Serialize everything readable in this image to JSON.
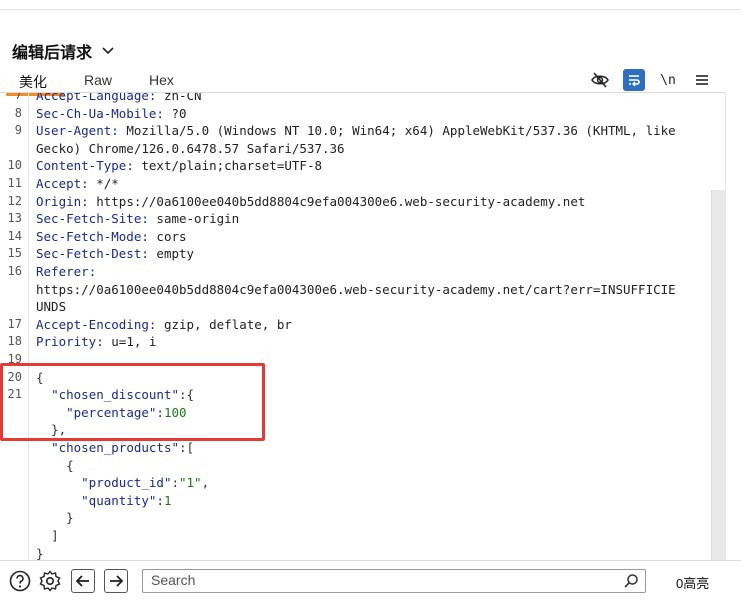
{
  "header": {
    "title": "编辑后请求"
  },
  "tabs": [
    {
      "label": "美化",
      "active": true
    },
    {
      "label": "Raw",
      "active": false
    },
    {
      "label": "Hex",
      "active": false
    }
  ],
  "toolbar": {
    "icons": [
      "eye-slash-icon",
      "wrap-text-icon",
      "newline-icon",
      "menu-icon"
    ],
    "newline_label": "\\n"
  },
  "editor": {
    "lines": [
      {
        "num": "7",
        "key": "Accept-Language",
        "sep": ": ",
        "value": "zh-CN"
      },
      {
        "num": "8",
        "key": "Sec-Ch-Ua-Mobile",
        "sep": ": ",
        "value": "?0"
      },
      {
        "num": "9",
        "key": "User-Agent",
        "sep": ": ",
        "value": "Mozilla/5.0 (Windows NT 10.0; Win64; x64) AppleWebKit/537.36 (KHTML, like"
      },
      {
        "num": "",
        "key": "",
        "sep": "",
        "value": "Gecko) Chrome/126.0.6478.57 Safari/537.36"
      },
      {
        "num": "10",
        "key": "Content-Type",
        "sep": ": ",
        "value": "text/plain;charset=UTF-8"
      },
      {
        "num": "11",
        "key": "Accept",
        "sep": ": ",
        "value": "*/*"
      },
      {
        "num": "12",
        "key": "Origin",
        "sep": ": ",
        "value": "https://0a6100ee040b5dd8804c9efa004300e6.web-security-academy.net"
      },
      {
        "num": "13",
        "key": "Sec-Fetch-Site",
        "sep": ": ",
        "value": "same-origin"
      },
      {
        "num": "14",
        "key": "Sec-Fetch-Mode",
        "sep": ": ",
        "value": "cors"
      },
      {
        "num": "15",
        "key": "Sec-Fetch-Dest",
        "sep": ": ",
        "value": "empty"
      },
      {
        "num": "16",
        "key": "Referer",
        "sep": ":",
        "value": ""
      },
      {
        "num": "",
        "key": "",
        "sep": "",
        "value": "https://0a6100ee040b5dd8804c9efa004300e6.web-security-academy.net/cart?err=INSUFFICIE"
      },
      {
        "num": "",
        "key": "",
        "sep": "",
        "value": "UNDS"
      },
      {
        "num": "17",
        "key": "Accept-Encoding",
        "sep": ": ",
        "value": "gzip, deflate, br"
      },
      {
        "num": "18",
        "key": "Priority",
        "sep": ": ",
        "value": "u=1, i"
      },
      {
        "num": "19",
        "key": "",
        "sep": "",
        "value": ""
      }
    ],
    "json_lines": [
      {
        "num": "20",
        "indent": "",
        "parts": [
          [
            "p",
            "{"
          ]
        ]
      },
      {
        "num": "21",
        "indent": "  ",
        "parts": [
          [
            "k",
            "\"chosen_discount\""
          ],
          [
            "p",
            ":{"
          ]
        ]
      },
      {
        "num": "",
        "indent": "    ",
        "parts": [
          [
            "k",
            "\"percentage\""
          ],
          [
            "p",
            ":"
          ],
          [
            "n",
            "100"
          ]
        ]
      },
      {
        "num": "",
        "indent": "  ",
        "parts": [
          [
            "p",
            "},"
          ]
        ]
      },
      {
        "num": "",
        "indent": "  ",
        "parts": [
          [
            "k",
            "\"chosen_products\""
          ],
          [
            "p",
            ":["
          ]
        ]
      },
      {
        "num": "",
        "indent": "    ",
        "parts": [
          [
            "p",
            "{"
          ]
        ]
      },
      {
        "num": "",
        "indent": "      ",
        "parts": [
          [
            "k",
            "\"product_id\""
          ],
          [
            "p",
            ":"
          ],
          [
            "s",
            "\"1\""
          ],
          [
            "p",
            ","
          ]
        ]
      },
      {
        "num": "",
        "indent": "      ",
        "parts": [
          [
            "k",
            "\"quantity\""
          ],
          [
            "p",
            ":"
          ],
          [
            "n",
            "1"
          ]
        ]
      },
      {
        "num": "",
        "indent": "    ",
        "parts": [
          [
            "p",
            "}"
          ]
        ]
      },
      {
        "num": "",
        "indent": "  ",
        "parts": [
          [
            "p",
            "]"
          ]
        ]
      },
      {
        "num": "",
        "indent": "",
        "parts": [
          [
            "p",
            "}"
          ]
        ]
      }
    ]
  },
  "bottombar": {
    "search_placeholder": "Search",
    "hits": "0高亮"
  },
  "colors": {
    "accent": "#f28c28",
    "selected_tool": "#2f6fc0",
    "highlight_box": "#e53935"
  }
}
